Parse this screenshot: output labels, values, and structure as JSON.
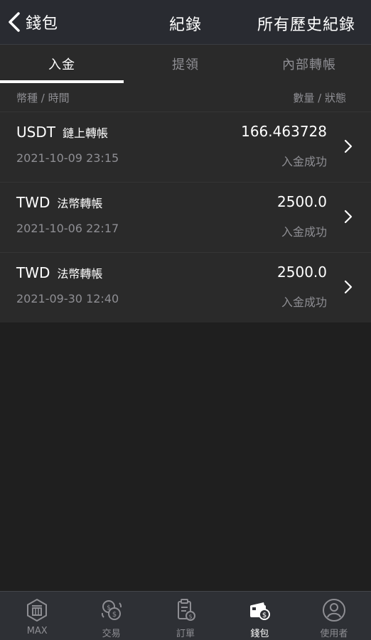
{
  "header": {
    "back_label": "錢包",
    "title": "紀錄",
    "history_label": "所有歷史紀錄"
  },
  "tabs": [
    {
      "label": "入金",
      "active": true
    },
    {
      "label": "提領",
      "active": false
    },
    {
      "label": "內部轉帳",
      "active": false
    }
  ],
  "columns": {
    "left": "幣種 / 時間",
    "right": "數量 / 狀態"
  },
  "records": [
    {
      "currency": "USDT",
      "type": "鏈上轉帳",
      "time": "2021-10-09 23:15",
      "amount": "166.463728",
      "status": "入金成功"
    },
    {
      "currency": "TWD",
      "type": "法幣轉帳",
      "time": "2021-10-06 22:17",
      "amount": "2500.0",
      "status": "入金成功"
    },
    {
      "currency": "TWD",
      "type": "法幣轉帳",
      "time": "2021-09-30 12:40",
      "amount": "2500.0",
      "status": "入金成功"
    }
  ],
  "bottom_nav": [
    {
      "label": "MAX",
      "icon": "max-logo-icon",
      "active": false
    },
    {
      "label": "交易",
      "icon": "exchange-icon",
      "active": false
    },
    {
      "label": "訂單",
      "icon": "orders-icon",
      "active": false
    },
    {
      "label": "錢包",
      "icon": "wallet-icon",
      "active": true
    },
    {
      "label": "使用者",
      "icon": "user-icon",
      "active": false
    }
  ],
  "colors": {
    "background": "#1f1f1f",
    "header_bg": "#292b31",
    "row_bg": "#2a2a2a",
    "muted_text": "#8e8e93",
    "nav_bg": "#2e3035"
  }
}
